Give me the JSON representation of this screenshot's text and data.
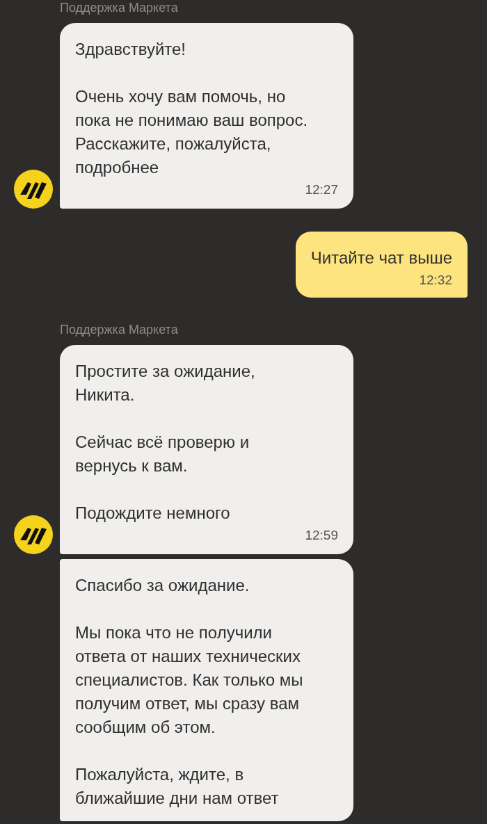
{
  "groups": [
    {
      "sender": "Поддержка Маркета",
      "messages": [
        {
          "kind": "incoming",
          "avatar": true,
          "text": "Здравствуйте!\n\nОчень хочу вам помочь, но\nпока не понимаю ваш вопрос.\nРасскажите, пожалуйста,\nподробнее",
          "time": "12:27"
        }
      ]
    },
    {
      "messages": [
        {
          "kind": "outgoing",
          "text": "Читайте чат выше",
          "time": "12:32"
        }
      ]
    },
    {
      "sender": "Поддержка Маркета",
      "messages": [
        {
          "kind": "incoming",
          "avatar": true,
          "text": "Простите за ожидание,\nНикита.\n\nСейчас всё проверю и\nвернусь к вам.\n\nПодождите немного",
          "time": "12:59"
        },
        {
          "kind": "incoming",
          "avatar": false,
          "text": "Спасибо за ожидание.\n\nМы пока что не получили\nответа от наших технических\nспециалистов. Как только мы\nполучим ответ, мы сразу вам\nсообщим об этом.\n\nПожалуйста, ждите, в\nближайшие дни нам ответ"
        }
      ]
    }
  ]
}
